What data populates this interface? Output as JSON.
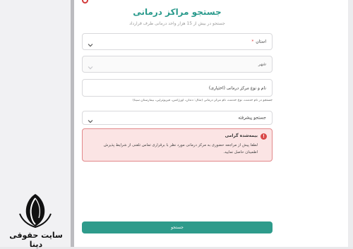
{
  "header": {
    "title": "جستجو مراکز درمانی",
    "subtitle": "جستجو در بیش از 15 هزار واحد درمانی طرف قرارداد"
  },
  "form": {
    "province": {
      "label": "استان",
      "required_mark": "*"
    },
    "city": {
      "label": "شهر"
    },
    "name_input": {
      "placeholder": "نام و نوع مرکز درمانی (اختیاری)"
    },
    "hint": "جستجو در نام خدمت، نوع خدمت، نام مرکز درمانی (مثال: دندان، اورژانس، فیزیوتراپی، بیمارستان سینا)",
    "advanced": {
      "label": "جستجو پیشرفته"
    }
  },
  "alert": {
    "icon": "!",
    "title": "بیمه‌شده گرامی",
    "body": "لطفا پیش از مراجعه حضوری به مرکز درمانی مورد نظر با برقراری تماس تلفنی از شرایط پذیرش اطمینان حاصل نمایید."
  },
  "actions": {
    "submit_label": "جستجو"
  },
  "branding": {
    "watermark_name": "سایت حقوقی دینا"
  },
  "colors": {
    "accent": "#2e9b8b",
    "title": "#2a9a8c",
    "alert_bg": "#fbe4e4",
    "alert_border": "#e2888a",
    "alert_icon": "#d94848"
  }
}
